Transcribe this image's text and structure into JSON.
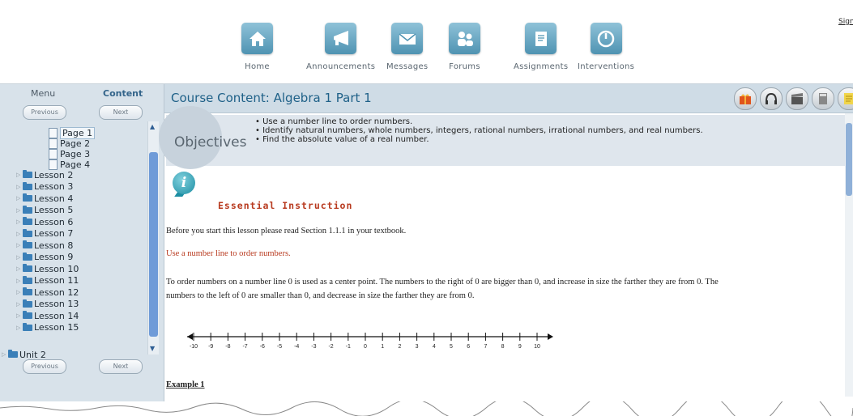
{
  "topnav": {
    "items": [
      {
        "label": "Home",
        "icon": "home-icon"
      },
      {
        "label": "Announcements",
        "icon": "megaphone-icon"
      },
      {
        "label": "Messages",
        "icon": "envelope-icon"
      },
      {
        "label": "Forums",
        "icon": "people-icon"
      },
      {
        "label": "Assignments",
        "icon": "document-icon"
      },
      {
        "label": "Interventions",
        "icon": "gauge-icon"
      }
    ],
    "signout": "Sign O"
  },
  "sidebar": {
    "tabs": [
      "Menu",
      "Content"
    ],
    "active_tab": "Content",
    "previous": "Previous",
    "next": "Next",
    "pages": [
      "Page 1",
      "Page 2",
      "Page 3",
      "Page 4"
    ],
    "lessons": [
      "Lesson 2",
      "Lesson 3",
      "Lesson 4",
      "Lesson 5",
      "Lesson 6",
      "Lesson 7",
      "Lesson 8",
      "Lesson 9",
      "Lesson 10",
      "Lesson 11",
      "Lesson 12",
      "Lesson 13",
      "Lesson 14",
      "Lesson 15"
    ],
    "unit": "Unit 2"
  },
  "content": {
    "title": "Course Content: Algebra 1 Part 1",
    "tools": [
      "gift-icon",
      "headphones-icon",
      "clapperboard-icon",
      "calculator-icon",
      "notepad-icon"
    ],
    "objectives_label": "Objectives",
    "objectives": [
      "Use a number line to order numbers.",
      "Identify natural numbers, whole numbers, integers, rational numbers, irrational numbers, and real numbers.",
      "Find the absolute value of a real number."
    ],
    "essential": "Essential Instruction",
    "intro": "Before you start this lesson please read Section 1.1.1 in your textbook.",
    "subhead": "Use a number line to order numbers.",
    "para1": "To order numbers on a number line 0 is used as a center point.  The numbers to the right of 0 are bigger than 0, and increase in size the farther they are from 0.  The",
    "para2": "numbers to the left of 0 are smaller than 0, and decrease in size the farther they are from 0.",
    "numberline": [
      "-10",
      "-9",
      "-8",
      "-7",
      "-6",
      "-5",
      "-4",
      "-3",
      "-2",
      "-1",
      "0",
      "1",
      "2",
      "3",
      "4",
      "5",
      "6",
      "7",
      "8",
      "9",
      "10"
    ],
    "example": "Example 1"
  },
  "colors": {
    "accent": "#1f6188",
    "instruction": "#b83a1f",
    "panel": "#d8e2ea"
  }
}
